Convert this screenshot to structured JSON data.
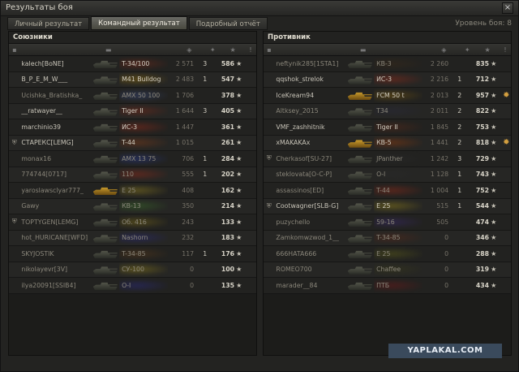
{
  "window": {
    "title": "Результаты боя",
    "close": "×"
  },
  "tabs": [
    "Личный результат",
    "Командный результат",
    "Подробный отчёт"
  ],
  "active_tab": 1,
  "level_label": "Уровень боя: 8",
  "watermark": "YAPLAKAL.COM",
  "allies": {
    "title": "Союзники",
    "rows": [
      {
        "name": "kalech[BoNE]",
        "vehicle": "T-34/100",
        "dmg": "2 571",
        "kills": "3",
        "exp": "586",
        "color": "#7a2a1a",
        "gold": false,
        "badge": "",
        "medal": false,
        "dead": false
      },
      {
        "name": "B_P_E_M_W___",
        "vehicle": "M41 Bulldog",
        "dmg": "2 483",
        "kills": "1",
        "exp": "547",
        "color": "#8a6a10",
        "gold": false,
        "badge": "",
        "medal": false,
        "dead": false
      },
      {
        "name": "Ucishka_Bratishka_",
        "vehicle": "AMX 50 100",
        "dmg": "1 706",
        "kills": "",
        "exp": "378",
        "color": "#3a4a7a",
        "gold": false,
        "badge": "",
        "medal": false,
        "dead": true
      },
      {
        "name": "__ratwayer__",
        "vehicle": "Tiger II",
        "dmg": "1 644",
        "kills": "3",
        "exp": "405",
        "color": "#7a2a1a",
        "gold": false,
        "badge": "",
        "medal": false,
        "dead": false
      },
      {
        "name": "marchinio39",
        "vehicle": "ИС-3",
        "dmg": "1 447",
        "kills": "",
        "exp": "361",
        "color": "#8a2a1a",
        "gold": false,
        "badge": "",
        "medal": false,
        "dead": false
      },
      {
        "name": "СТАРЕКС[LEMG]",
        "vehicle": "T-44",
        "dmg": "1 015",
        "kills": "",
        "exp": "261",
        "color": "#7a3a1a",
        "gold": false,
        "badge": "shield",
        "medal": false,
        "dead": false
      },
      {
        "name": "monax16",
        "vehicle": "AMX 13 75",
        "dmg": "706",
        "kills": "1",
        "exp": "284",
        "color": "#2a3a8a",
        "gold": false,
        "badge": "",
        "medal": false,
        "dead": true
      },
      {
        "name": "774744[0717]",
        "vehicle": "110",
        "dmg": "555",
        "kills": "1",
        "exp": "202",
        "color": "#8a2a1a",
        "gold": false,
        "badge": "",
        "medal": false,
        "dead": true
      },
      {
        "name": "yaroslawsclyar777_",
        "vehicle": "E 25",
        "dmg": "408",
        "kills": "",
        "exp": "162",
        "color": "#8a7a20",
        "gold": true,
        "badge": "",
        "medal": false,
        "dead": true
      },
      {
        "name": "Gawy",
        "vehicle": "КВ-13",
        "dmg": "350",
        "kills": "",
        "exp": "214",
        "color": "#3a6a2a",
        "gold": false,
        "badge": "",
        "medal": false,
        "dead": true
      },
      {
        "name": "TOPTYGEN[LEMG]",
        "vehicle": "Об. 416",
        "dmg": "243",
        "kills": "",
        "exp": "133",
        "color": "#7a6a1a",
        "gold": false,
        "badge": "shield",
        "medal": false,
        "dead": true
      },
      {
        "name": "hot_HURICANE[WFD]",
        "vehicle": "Nashorn",
        "dmg": "232",
        "kills": "",
        "exp": "183",
        "color": "#2a2a7a",
        "gold": false,
        "badge": "",
        "medal": false,
        "dead": true
      },
      {
        "name": "SKYJOSTIK",
        "vehicle": "T-34-85",
        "dmg": "117",
        "kills": "1",
        "exp": "176",
        "color": "#5a3a1a",
        "gold": false,
        "badge": "",
        "medal": false,
        "dead": true
      },
      {
        "name": "nikolayevr[3V]",
        "vehicle": "СУ-100",
        "dmg": "0",
        "kills": "",
        "exp": "100",
        "color": "#8a7a1a",
        "gold": false,
        "badge": "",
        "medal": false,
        "dead": true
      },
      {
        "name": "ilya20091[SSIB4]",
        "vehicle": "О-I",
        "dmg": "0",
        "kills": "",
        "exp": "135",
        "color": "#2a2a7a",
        "gold": false,
        "badge": "",
        "medal": false,
        "dead": true
      }
    ]
  },
  "enemies": {
    "title": "Противник",
    "rows": [
      {
        "name": "neftynik285[1STA1]",
        "vehicle": "КВ-3",
        "dmg": "2 260",
        "kills": "",
        "exp": "835",
        "color": "#3a2a1a",
        "gold": false,
        "badge": "",
        "medal": false,
        "dead": true
      },
      {
        "name": "qqshok_strelok",
        "vehicle": "ИС-3",
        "dmg": "2 216",
        "kills": "1",
        "exp": "712",
        "color": "#8a2a1a",
        "gold": false,
        "badge": "",
        "medal": false,
        "dead": false
      },
      {
        "name": "IceKream94",
        "vehicle": "FCM 50 t",
        "dmg": "2 013",
        "kills": "2",
        "exp": "957",
        "color": "#7a5a10",
        "gold": true,
        "badge": "",
        "medal": true,
        "dead": false
      },
      {
        "name": "Altksey_2015",
        "vehicle": "T34",
        "dmg": "2 011",
        "kills": "2",
        "exp": "822",
        "color": "#2a2a3a",
        "gold": false,
        "badge": "",
        "medal": false,
        "dead": true
      },
      {
        "name": "VMF_zashhitnik",
        "vehicle": "Tiger II",
        "dmg": "1 845",
        "kills": "2",
        "exp": "753",
        "color": "#5a2a1a",
        "gold": false,
        "badge": "",
        "medal": false,
        "dead": false
      },
      {
        "name": "xMAKAKAx",
        "vehicle": "КВ-5",
        "dmg": "1 441",
        "kills": "2",
        "exp": "818",
        "color": "#8a3a10",
        "gold": true,
        "badge": "",
        "medal": true,
        "dead": false
      },
      {
        "name": "Cherkasof[SU-27]",
        "vehicle": "JPanther",
        "dmg": "1 242",
        "kills": "3",
        "exp": "729",
        "color": "#2a2a2a",
        "gold": false,
        "badge": "shield",
        "medal": false,
        "dead": true
      },
      {
        "name": "steklovata[O-C-P]",
        "vehicle": "О-I",
        "dmg": "1 128",
        "kills": "1",
        "exp": "743",
        "color": "#2a2a2a",
        "gold": false,
        "badge": "",
        "medal": false,
        "dead": true
      },
      {
        "name": "assassinos[ED]",
        "vehicle": "T-44",
        "dmg": "1 004",
        "kills": "1",
        "exp": "752",
        "color": "#8a2a1a",
        "gold": false,
        "badge": "",
        "medal": false,
        "dead": true
      },
      {
        "name": "Cootwagner[SLB-G]",
        "vehicle": "E 25",
        "dmg": "515",
        "kills": "1",
        "exp": "544",
        "color": "#8a7a1a",
        "gold": false,
        "badge": "shield",
        "medal": false,
        "dead": false
      },
      {
        "name": "puzychello",
        "vehicle": "59-16",
        "dmg": "505",
        "kills": "",
        "exp": "474",
        "color": "#3a2a6a",
        "gold": false,
        "badge": "",
        "medal": false,
        "dead": true
      },
      {
        "name": "Zamkomwzwod_1__",
        "vehicle": "T-34-85",
        "dmg": "0",
        "kills": "",
        "exp": "346",
        "color": "#5a2a1a",
        "gold": false,
        "badge": "",
        "medal": false,
        "dead": true
      },
      {
        "name": "666HATA666",
        "vehicle": "E 25",
        "dmg": "0",
        "kills": "",
        "exp": "288",
        "color": "#5a5a1a",
        "gold": false,
        "badge": "",
        "medal": false,
        "dead": true
      },
      {
        "name": "ROMEO700",
        "vehicle": "Chaffee",
        "dmg": "0",
        "kills": "",
        "exp": "319",
        "color": "#3a3a1a",
        "gold": false,
        "badge": "",
        "medal": false,
        "dead": true
      },
      {
        "name": "marader__84",
        "vehicle": "ПТБ",
        "dmg": "0",
        "kills": "",
        "exp": "434",
        "color": "#6a1a1a",
        "gold": false,
        "badge": "",
        "medal": false,
        "dead": true
      }
    ]
  }
}
